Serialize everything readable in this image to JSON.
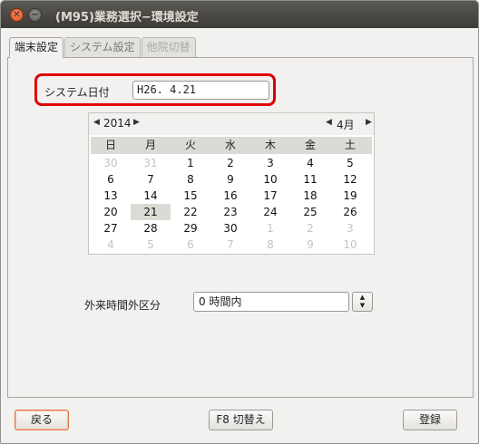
{
  "window": {
    "title": "(M95)業務選択−環境設定"
  },
  "tabs": [
    {
      "label": "端末設定"
    },
    {
      "label": "システム設定"
    },
    {
      "label": "他院切替"
    }
  ],
  "system_date": {
    "label": "システム日付",
    "value": "H26. 4.21"
  },
  "calendar": {
    "year": "2014",
    "month": "4月",
    "weekdays": [
      "日",
      "月",
      "火",
      "水",
      "木",
      "金",
      "土"
    ],
    "days": [
      [
        "30",
        "31",
        "1",
        "2",
        "3",
        "4",
        "5"
      ],
      [
        "6",
        "7",
        "8",
        "9",
        "10",
        "11",
        "12"
      ],
      [
        "13",
        "14",
        "15",
        "16",
        "17",
        "18",
        "19"
      ],
      [
        "20",
        "21",
        "22",
        "23",
        "24",
        "25",
        "26"
      ],
      [
        "27",
        "28",
        "29",
        "30",
        "1",
        "2",
        "3"
      ],
      [
        "4",
        "5",
        "6",
        "7",
        "8",
        "9",
        "10"
      ]
    ],
    "selected_day": "21"
  },
  "outpatient": {
    "label": "外来時間外区分",
    "value": "0 時間内"
  },
  "footer": {
    "back_label": "戻る",
    "f8_label": "F8 切替え",
    "register_label": "登録"
  },
  "colors": {
    "highlight_border": "#e00000",
    "titlebar": "#3c3b37",
    "close_button": "#e0501f"
  }
}
